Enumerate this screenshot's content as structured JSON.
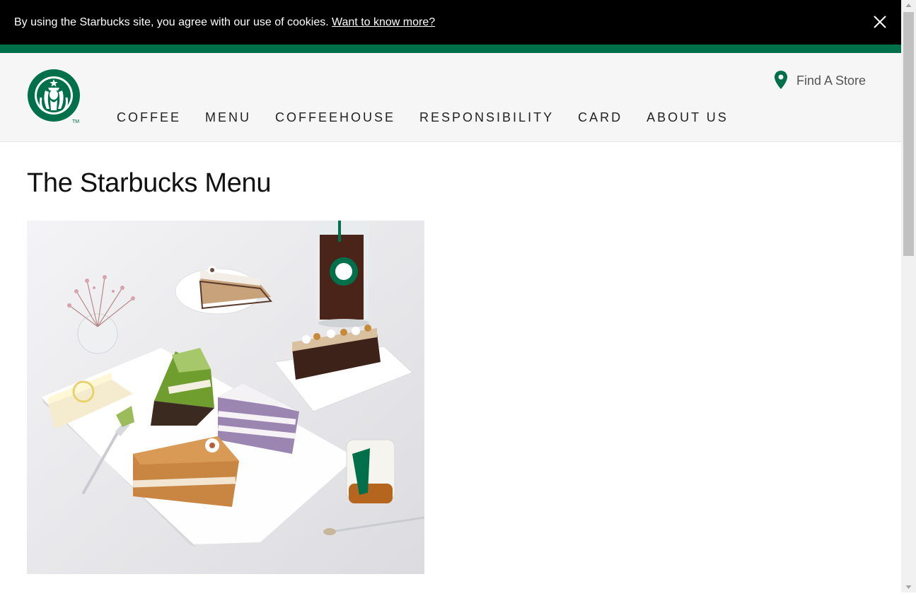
{
  "cookie_banner": {
    "text": "By using the Starbucks site, you agree with our use of cookies.",
    "link_label": "Want to know more?",
    "close_icon": "close-icon"
  },
  "header": {
    "logo_icon": "starbucks-siren-logo",
    "logo_trademark": "TM",
    "find_store": {
      "icon": "map-pin-icon",
      "label": "Find A Store"
    },
    "nav": [
      {
        "label": "COFFEE"
      },
      {
        "label": "MENU"
      },
      {
        "label": "COFFEEHOUSE"
      },
      {
        "label": "RESPONSIBILITY"
      },
      {
        "label": "CARD"
      },
      {
        "label": "ABOUT US"
      }
    ]
  },
  "main": {
    "title": "The Starbucks Menu",
    "hero_image": "menu-cakes-and-iced-coffee-photo"
  },
  "colors": {
    "brand_green": "#00704a",
    "cookie_bar_bg": "#000000",
    "header_bg": "#f6f6f6"
  }
}
